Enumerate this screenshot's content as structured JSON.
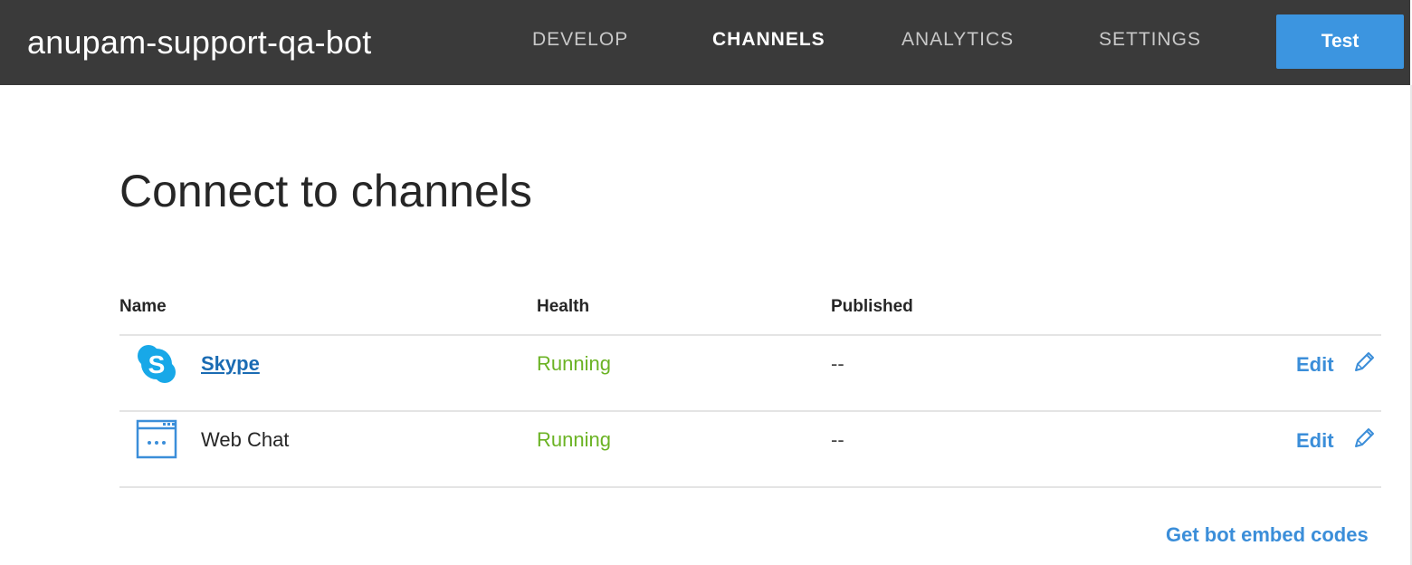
{
  "header": {
    "bot_name": "anupam-support-qa-bot",
    "tabs": [
      {
        "label": "DEVELOP",
        "active": false
      },
      {
        "label": "CHANNELS",
        "active": true
      },
      {
        "label": "ANALYTICS",
        "active": false
      },
      {
        "label": "SETTINGS",
        "active": false
      }
    ],
    "test_label": "Test"
  },
  "page": {
    "title": "Connect to channels"
  },
  "table": {
    "columns": [
      "Name",
      "Health",
      "Published"
    ],
    "rows": [
      {
        "icon": "skype-icon",
        "name": "Skype",
        "health": "Running",
        "published": "--",
        "edit": "Edit"
      },
      {
        "icon": "web-chat-icon",
        "name": "Web Chat",
        "health": "Running",
        "published": "--",
        "edit": "Edit"
      }
    ]
  },
  "embed_link": "Get bot embed codes",
  "colors": {
    "topbar": "#3a3a3a",
    "accent": "#3c95e0",
    "running": "#6bb324",
    "link": "#3b8ed9"
  }
}
